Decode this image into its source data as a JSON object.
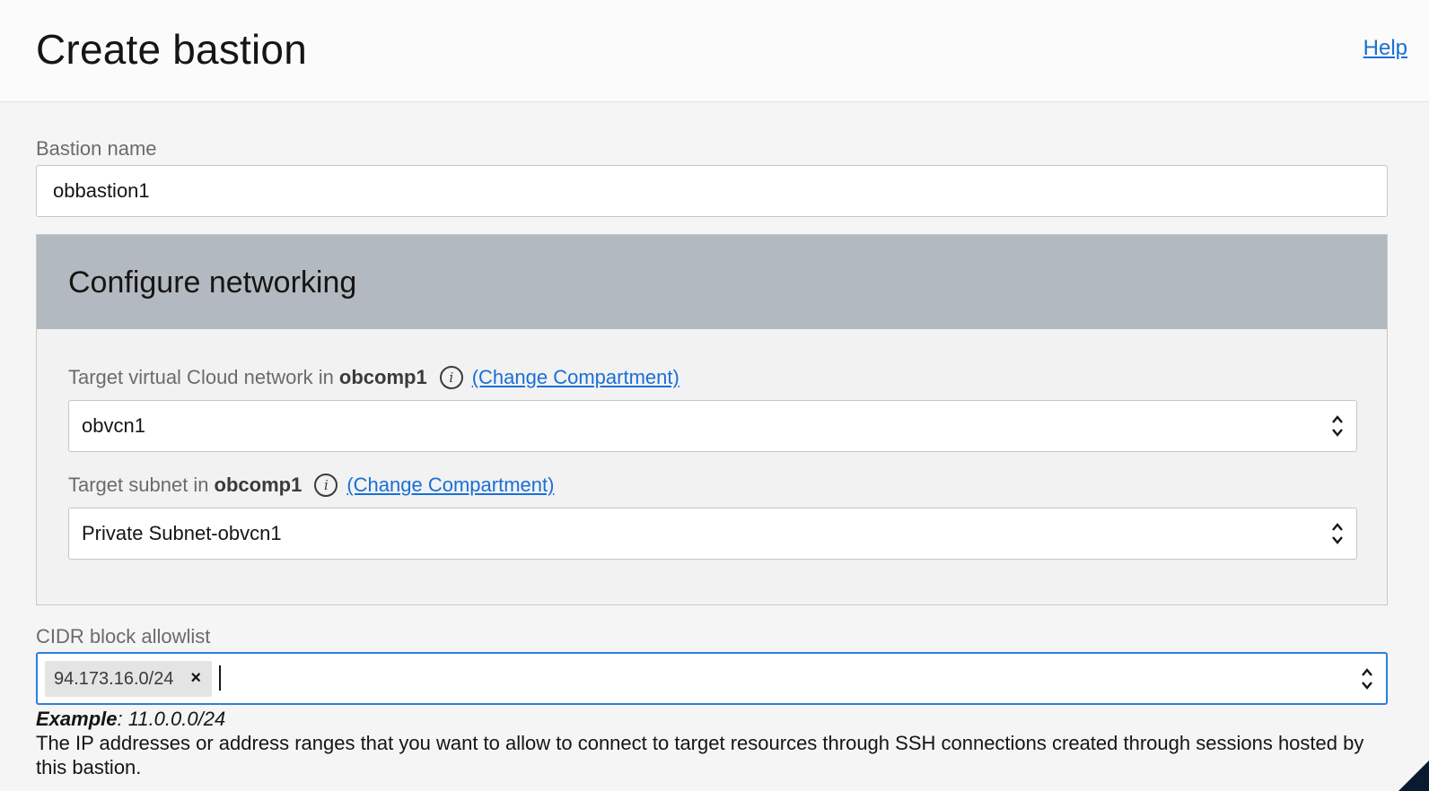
{
  "header": {
    "title": "Create bastion",
    "help_label": "Help"
  },
  "bastion_name": {
    "label": "Bastion name",
    "value": "obbastion1"
  },
  "networking": {
    "title": "Configure networking",
    "vcn": {
      "label_prefix": "Target virtual Cloud network in",
      "compartment": "obcomp1",
      "info_icon": "info-icon",
      "change_label": "(Change Compartment)",
      "value": "obvcn1"
    },
    "subnet": {
      "label_prefix": "Target subnet in",
      "compartment": "obcomp1",
      "info_icon": "info-icon",
      "change_label": "(Change Compartment)",
      "value": "Private Subnet-obvcn1"
    }
  },
  "cidr": {
    "label": "CIDR block allowlist",
    "chips": [
      "94.173.16.0/24"
    ],
    "chip_remove": "×",
    "example_label": "Example",
    "example_value": ": 11.0.0.0/24",
    "help_text": "The IP addresses or address ranges that you want to allow to connect to target resources through SSH connections created through sessions hosted by this bastion."
  },
  "colors": {
    "link": "#1a6fd6",
    "focus_border": "#2f7de1",
    "section_header": "#b3b9c0"
  }
}
